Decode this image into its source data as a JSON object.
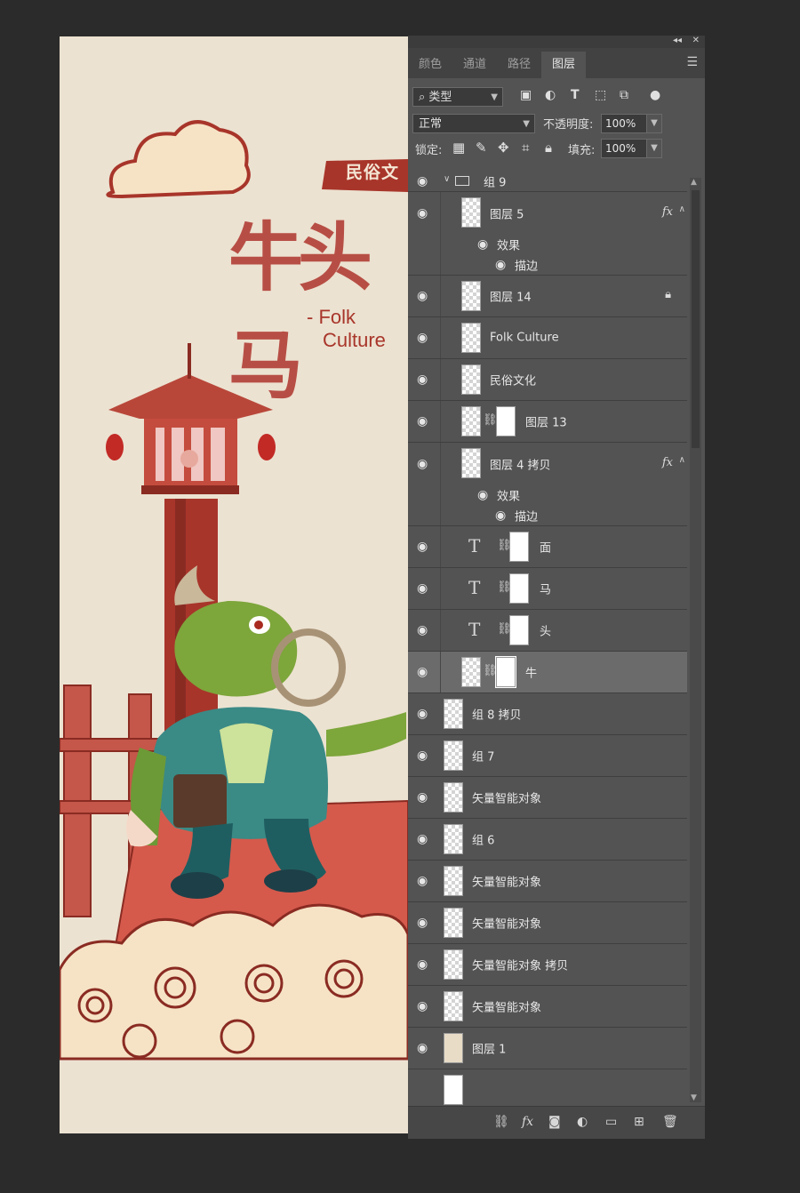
{
  "canvas": {
    "banner_text": "民俗文",
    "big_title": "牛头马",
    "folk_line1": "- Folk",
    "folk_line2": "Culture"
  },
  "panel": {
    "collapse_label": "◂◂",
    "close_label": "✕",
    "tabs": [
      {
        "label": "颜色"
      },
      {
        "label": "通道"
      },
      {
        "label": "路径"
      },
      {
        "label": "图层"
      }
    ],
    "filter": {
      "kind_label": "类型"
    },
    "blend_mode": "正常",
    "opacity_label": "不透明度:",
    "opacity_value": "100%",
    "lock_label": "锁定:",
    "fill_label": "填充:",
    "fill_value": "100%"
  },
  "layers": {
    "group9": "组 9",
    "l5": "图层 5",
    "l5_effects": "效果",
    "l5_stroke": "描边",
    "l14": "图层 14",
    "folk_culture": "Folk  Culture",
    "minsu": "民俗文化",
    "l13": "图层 13",
    "l4copy": "图层 4 拷贝",
    "l4_effects": "效果",
    "l4_stroke": "描边",
    "t_mian": "面",
    "t_ma": "马",
    "t_tou": "头",
    "t_niu": "牛",
    "g8copy": "组 8 拷贝",
    "g7": "组 7",
    "smart1": "矢量智能对象",
    "g6": "组 6",
    "smart2": "矢量智能对象",
    "smart3": "矢量智能对象",
    "smart_copy": "矢量智能对象 拷贝",
    "smart4": "矢量智能对象",
    "l1": "图层 1",
    "fx_label": "fx"
  }
}
